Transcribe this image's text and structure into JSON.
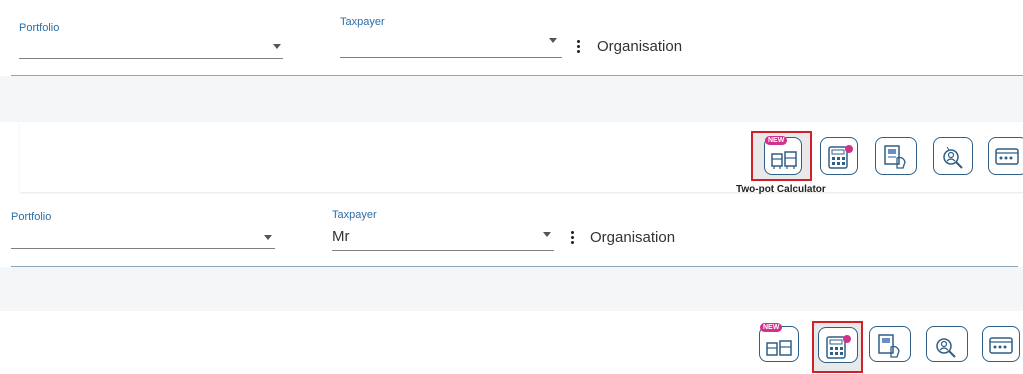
{
  "screen1": {
    "portfolio_label": "Portfolio",
    "portfolio_value": "",
    "taxpayer_label": "Taxpayer",
    "taxpayer_value": "",
    "organisation_label": "Organisation",
    "tools": [
      {
        "icon": "two-pot-calculator-icon",
        "badge": "NEW",
        "selected": true,
        "label": "Two-pot Calculator"
      },
      {
        "icon": "calculator-icon",
        "selected": false
      },
      {
        "icon": "document-hand-icon",
        "selected": false
      },
      {
        "icon": "person-search-icon",
        "selected": false
      },
      {
        "icon": "browser-tool-icon",
        "selected": false
      }
    ]
  },
  "screen2": {
    "portfolio_label": "Portfolio",
    "portfolio_value": "",
    "taxpayer_label": "Taxpayer",
    "taxpayer_value": "Mr",
    "organisation_label": "Organisation",
    "tools": [
      {
        "icon": "two-pot-calculator-icon",
        "badge": "NEW",
        "selected": false
      },
      {
        "icon": "calculator-icon",
        "selected": true
      },
      {
        "icon": "document-hand-icon",
        "selected": false
      },
      {
        "icon": "person-search-icon",
        "selected": false
      },
      {
        "icon": "browser-tool-icon",
        "selected": false
      }
    ]
  },
  "colors": {
    "selection": "#d0202a",
    "accent_label": "#2c6ea5",
    "icon_stroke": "#2f5f86",
    "badge": "#d0318a"
  }
}
